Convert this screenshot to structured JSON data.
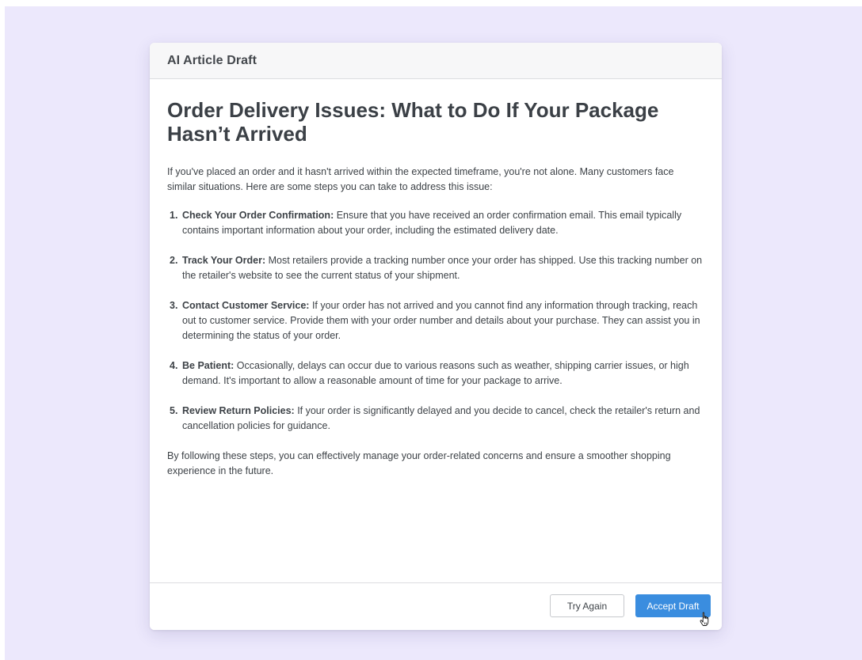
{
  "modal": {
    "title": "AI Article Draft"
  },
  "article": {
    "title": "Order Delivery Issues: What to Do If Your Package Hasn’t Arrived",
    "intro": "If you've placed an order and it hasn't arrived within the expected timeframe, you're not alone. Many customers face similar situations. Here are some steps you can take to address this issue:",
    "steps": [
      {
        "number": "1.",
        "heading": "Check Your Order Confirmation:",
        "text": " Ensure that you have received an order confirmation email. This email typically contains important information about your order, including the estimated delivery date."
      },
      {
        "number": "2.",
        "heading": "Track Your Order:",
        "text": " Most retailers provide a tracking number once your order has shipped. Use this tracking number on the retailer's website to see the current status of your shipment."
      },
      {
        "number": "3.",
        "heading": "Contact Customer Service:",
        "text": " If your order has not arrived and you cannot find any information through tracking, reach out to customer service. Provide them with your order number and details about your purchase. They can assist you in determining the status of your order."
      },
      {
        "number": "4.",
        "heading": "Be Patient:",
        "text": " Occasionally, delays can occur due to various reasons such as weather, shipping carrier issues, or high demand. It's important to allow a reasonable amount of time for your package to arrive."
      },
      {
        "number": "5.",
        "heading": "Review Return Policies:",
        "text": " If your order is significantly delayed and you decide to cancel, check the retailer's return and cancellation policies for guidance."
      }
    ],
    "conclusion": "By following these steps, you can effectively manage your order-related concerns and ensure a smoother shopping experience in the future."
  },
  "footer": {
    "try_again_label": "Try Again",
    "accept_label": "Accept Draft"
  },
  "colors": {
    "backdrop": "#ece8fc",
    "primary": "#3a8ddf",
    "header_bg": "#f7f7f8"
  },
  "icons": {
    "cursor": "hand-pointer-icon"
  }
}
